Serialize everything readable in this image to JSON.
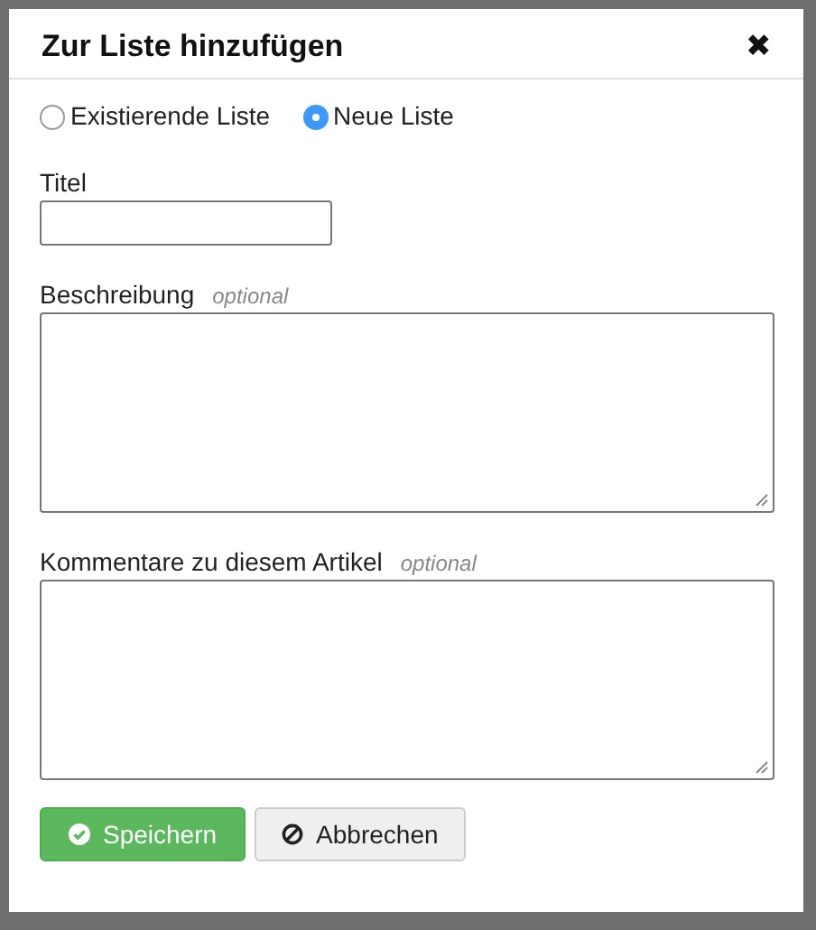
{
  "dialog": {
    "title": "Zur Liste hinzufügen",
    "close": "✖"
  },
  "list_choice": [
    {
      "label": "Existierende Liste",
      "selected": false
    },
    {
      "label": "Neue Liste",
      "selected": true
    }
  ],
  "fields": [
    {
      "kind": "input",
      "label": "Titel"
    },
    {
      "kind": "textarea",
      "label": "Beschreibung",
      "hint": "optional"
    },
    {
      "kind": "textarea",
      "label": "Kommentare zu diesem Artikel",
      "hint": "optional"
    }
  ],
  "buttons": [
    {
      "kind": "primary",
      "label": "Speichern"
    },
    {
      "kind": "secondary",
      "label": "Abbrechen"
    }
  ]
}
